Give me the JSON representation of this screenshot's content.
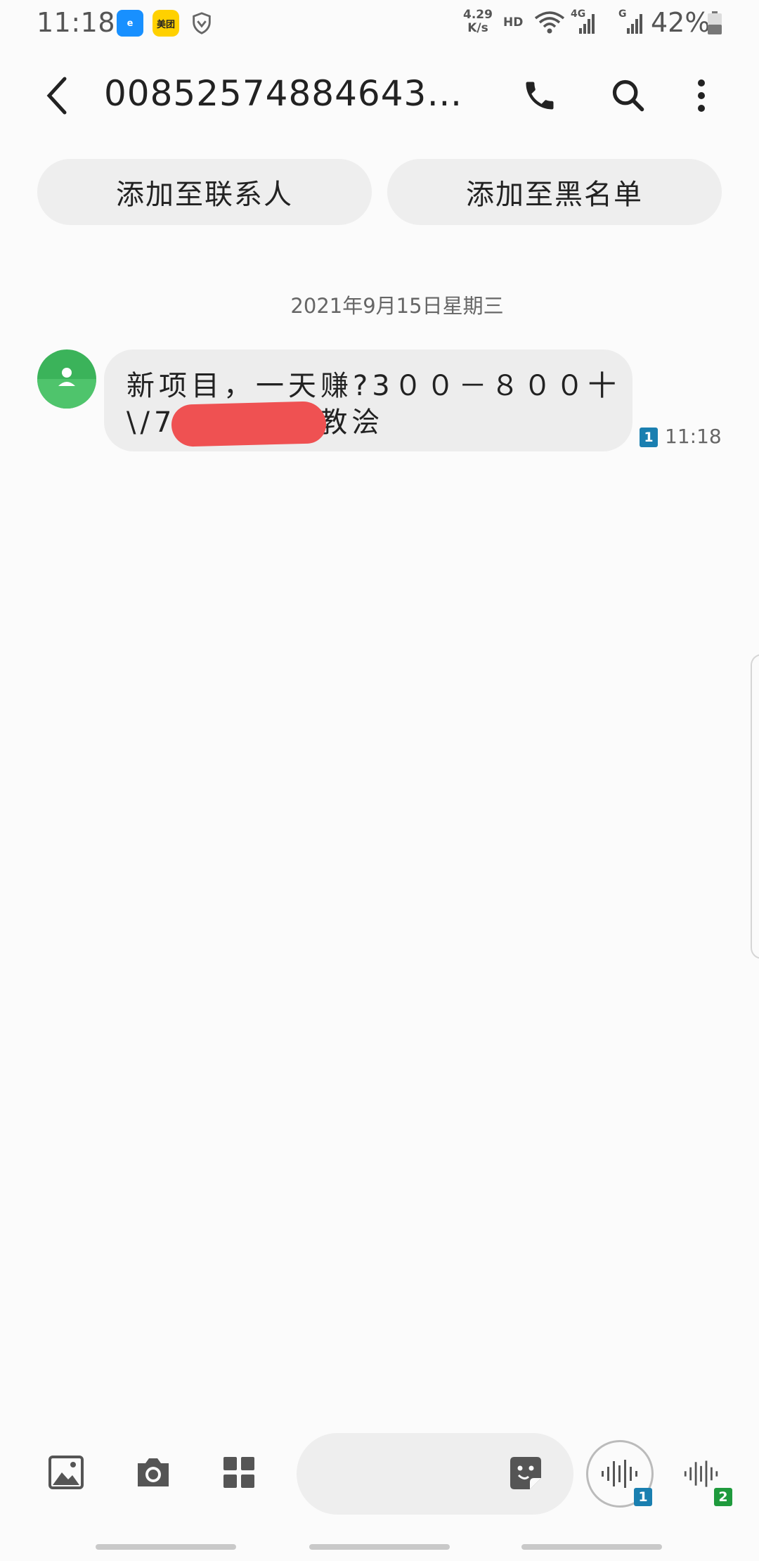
{
  "status_bar": {
    "time": "11:18",
    "app_icons": [
      {
        "name": "eleme-icon",
        "label": "e"
      },
      {
        "name": "meituan-icon",
        "label": "美团"
      }
    ],
    "net_speed_value": "4.29",
    "net_speed_unit": "K/s",
    "hd_label": "HD",
    "net_type_1": "4G",
    "net_type_2": "G",
    "battery": "42%"
  },
  "app_bar": {
    "title": "008525748846434..."
  },
  "actions": {
    "add_contact": "添加至联系人",
    "add_blacklist": "添加至黑名单"
  },
  "conversation": {
    "date": "2021年9月15日星期三",
    "message": {
      "line1": "新项目，一天赚?3００－８００十",
      "line2_prefix": "\\/7",
      "line2_suffix": "苞教浍",
      "sim_slot": "1",
      "time": "11:18"
    }
  },
  "composer": {
    "input_value": "",
    "voice1_sim": "1",
    "voice2_sim": "2"
  },
  "colors": {
    "avatar": "#3bb35a",
    "sim1": "#1a7fb0",
    "sim2": "#1f9a3d",
    "redaction": "#ef5152"
  }
}
